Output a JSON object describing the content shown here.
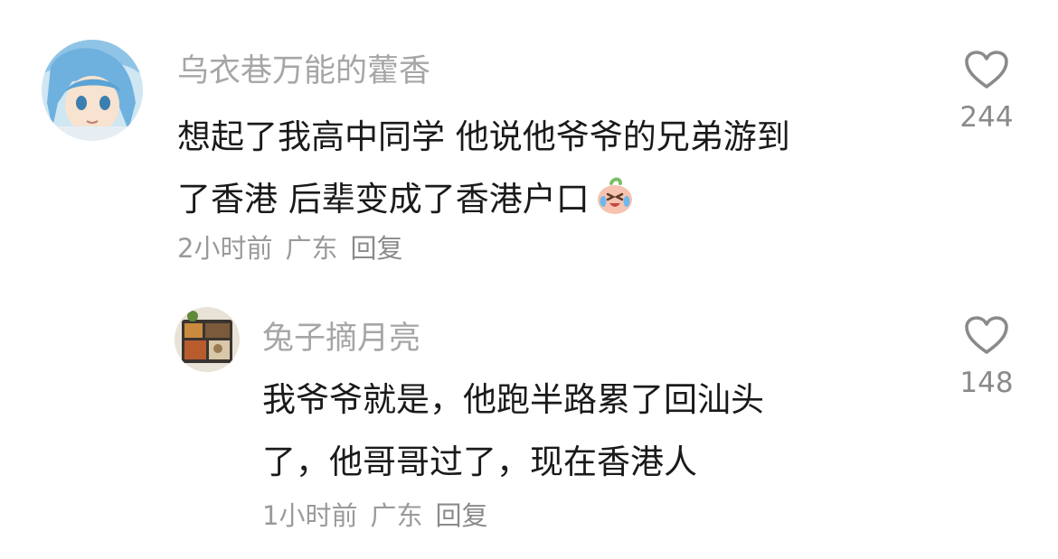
{
  "comments": [
    {
      "username": "乌衣巷万能的藿香",
      "text_lines": [
        "想起了我高中同学 他说他爷爷的兄弟游到",
        "了香港 后辈变成了香港户口"
      ],
      "emoji": "crying-laughing-peach-emoji",
      "time": "2小时前",
      "location": "广东",
      "reply_label": "回复",
      "like_count": "244",
      "avatar": "anime-blue-hair-avatar"
    },
    {
      "username": "兔子摘月亮",
      "text_lines": [
        "我爷爷就是，他跑半路累了回汕头",
        "了，他哥哥过了，现在香港人"
      ],
      "time": "1小时前",
      "location": "广东",
      "reply_label": "回复",
      "like_count": "148",
      "avatar": "food-tray-avatar"
    }
  ],
  "colors": {
    "username": "#a6a6a6",
    "text": "#1a1a1a",
    "meta": "#9a9a9a",
    "heart_outline": "#8a8a8a"
  }
}
